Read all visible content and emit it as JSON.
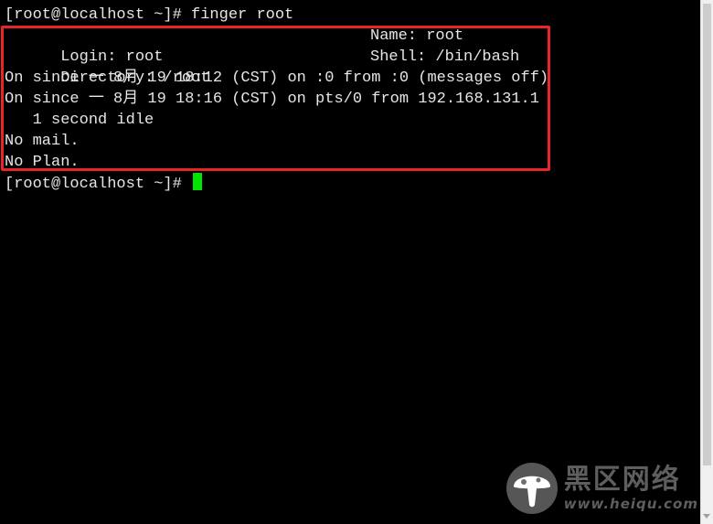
{
  "terminal": {
    "prompt_line": "[root@localhost ~]# finger root",
    "output": {
      "login_label_value": "Login: root",
      "name_label_value": "Name: root",
      "directory_label_value": "Directory: /root",
      "shell_label_value": "Shell: /bin/bash",
      "session_1": "On since 一 8月 19 18:12 (CST) on :0 from :0 (messages off)",
      "session_2": "On since 一 8月 19 18:16 (CST) on pts/0 from 192.168.131.1",
      "idle": "   1 second idle",
      "mail": "No mail.",
      "plan": "No Plan."
    },
    "current_prompt": "[root@localhost ~]# "
  },
  "watermark": {
    "name_cn": "黑区网络",
    "url": "www.heiqu.com"
  },
  "colors": {
    "background": "#000000",
    "text": "#e6e6e6",
    "cursor": "#00e400",
    "highlight": "#e8262a"
  }
}
